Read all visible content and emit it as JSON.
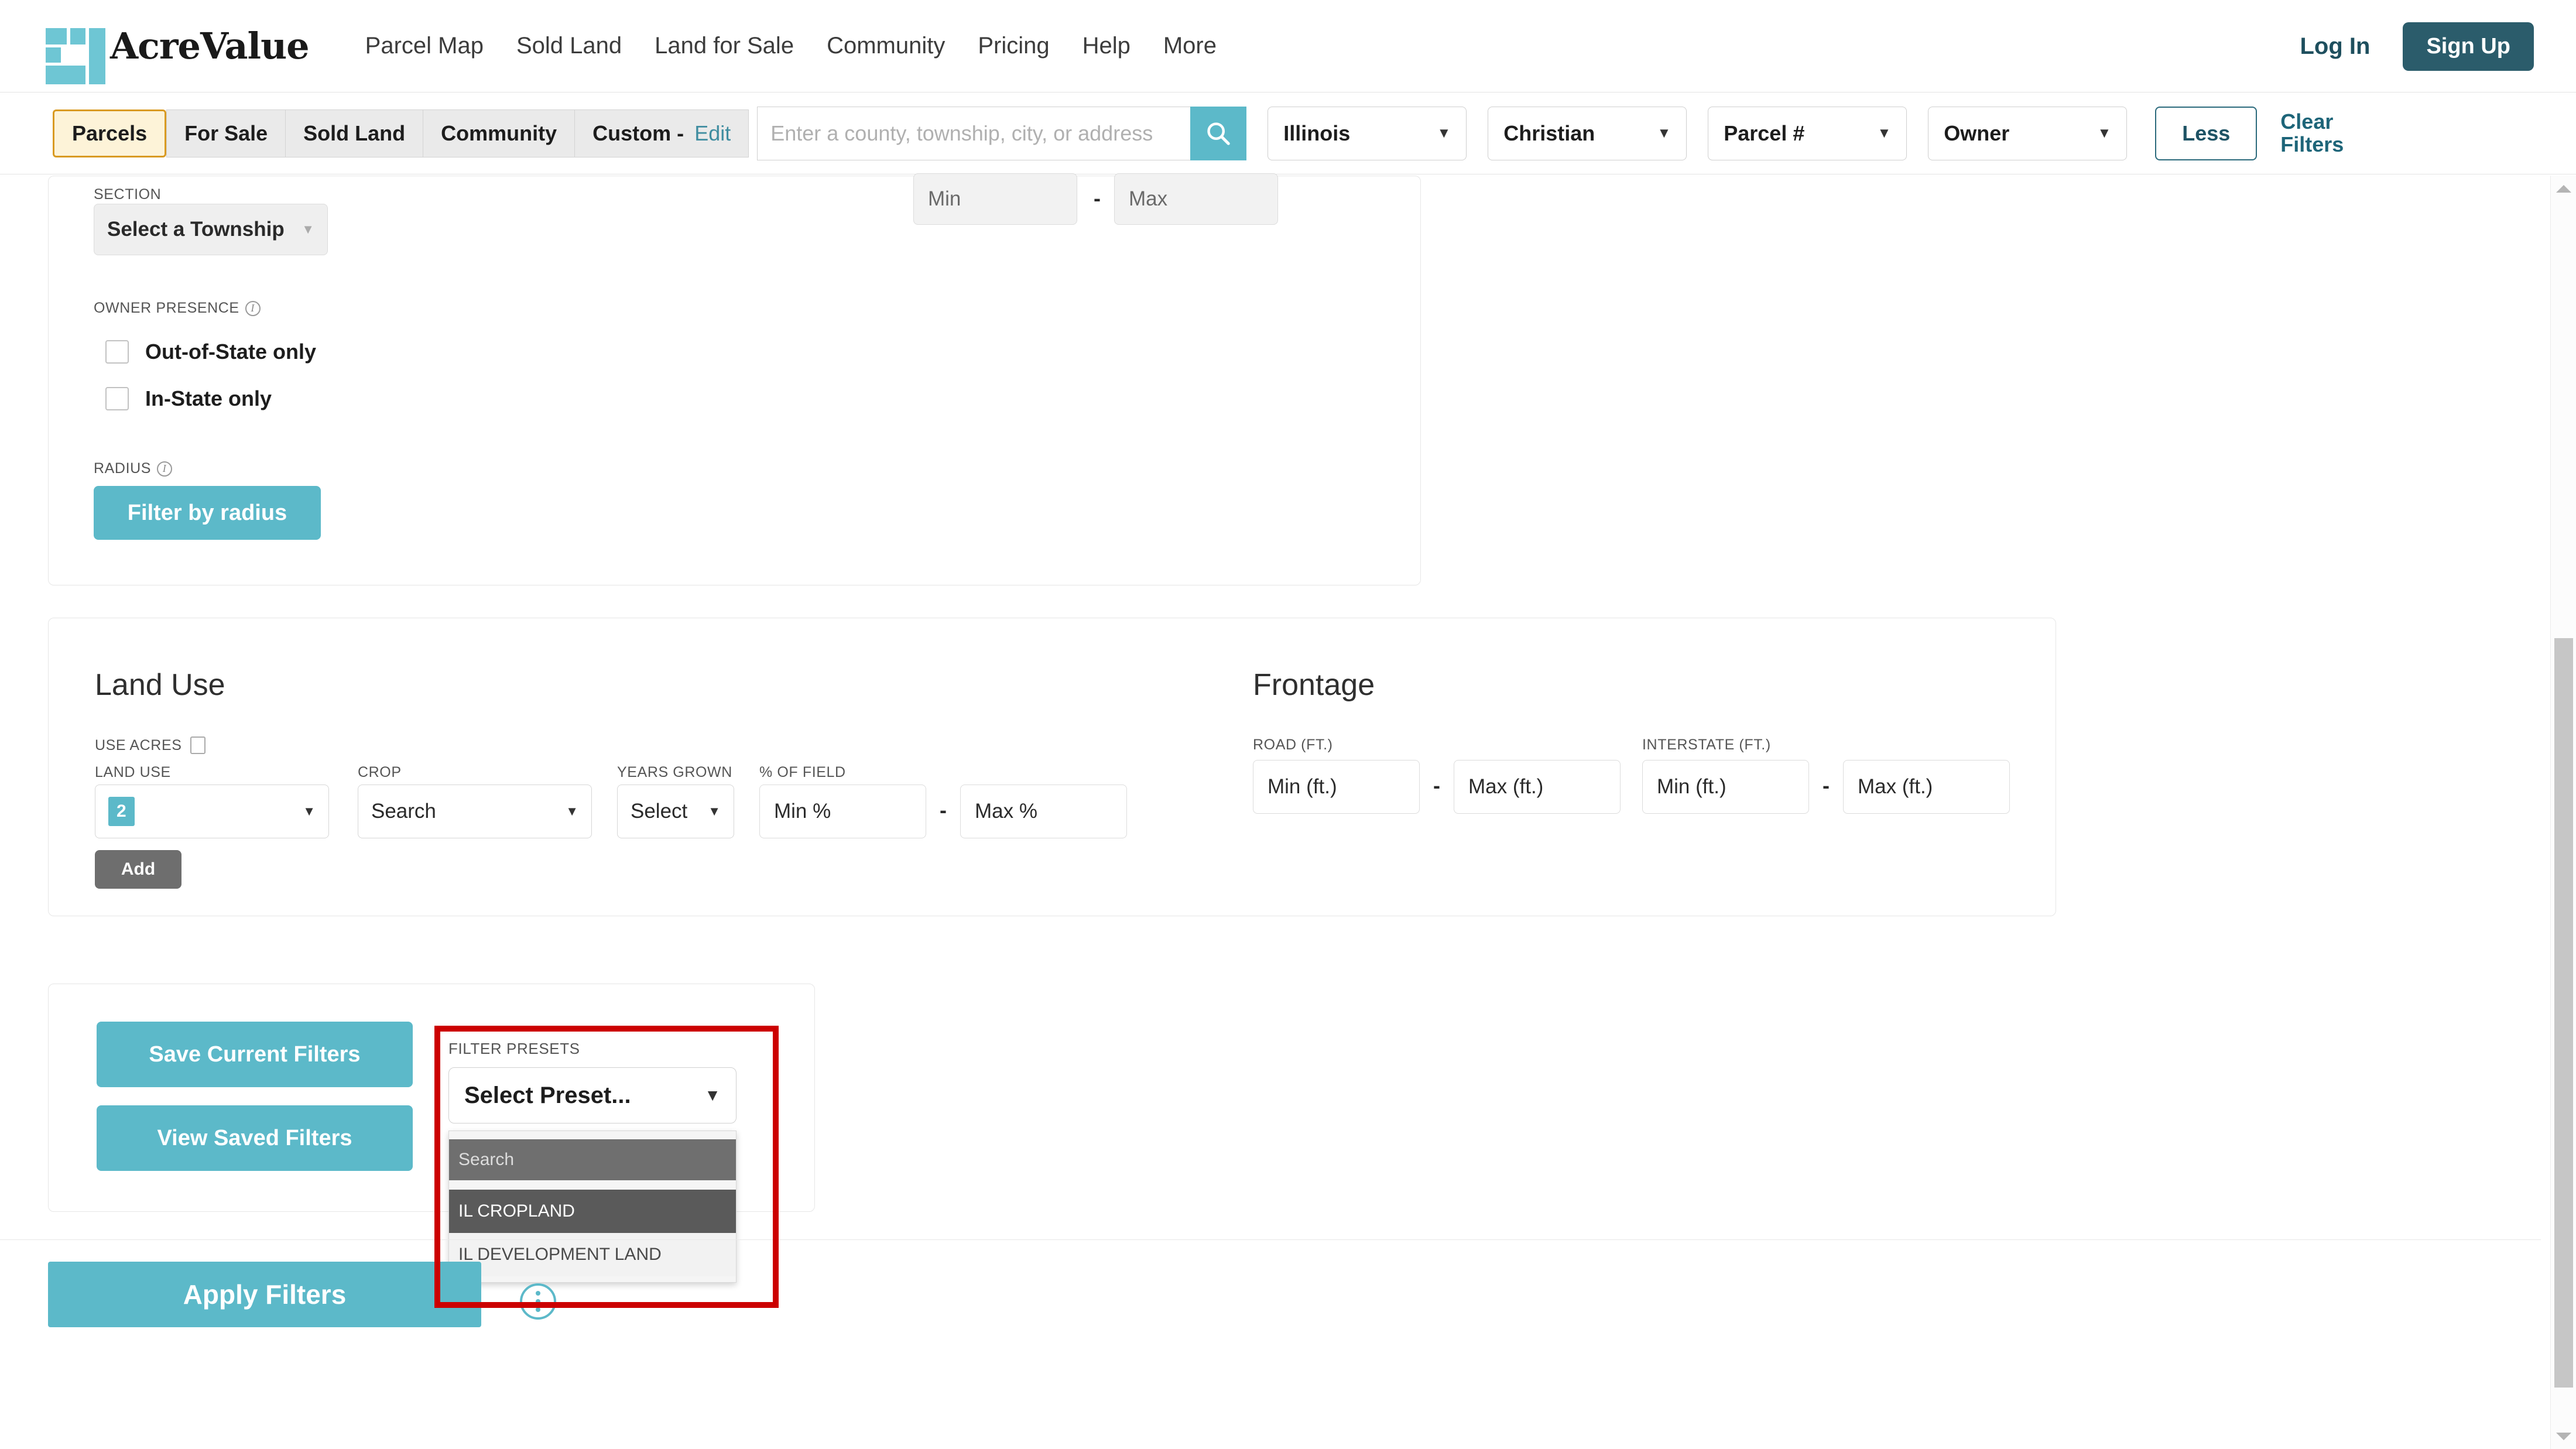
{
  "header": {
    "brand": "AcreValue",
    "nav": [
      {
        "label": "Parcel Map"
      },
      {
        "label": "Sold Land"
      },
      {
        "label": "Land for Sale"
      },
      {
        "label": "Community"
      },
      {
        "label": "Pricing"
      },
      {
        "label": "Help"
      },
      {
        "label": "More"
      }
    ],
    "login_label": "Log In",
    "signup_label": "Sign Up"
  },
  "filter_bar": {
    "tabs": [
      {
        "label": "Parcels",
        "active": true
      },
      {
        "label": "For Sale",
        "active": false
      },
      {
        "label": "Sold Land",
        "active": false
      },
      {
        "label": "Community",
        "active": false
      }
    ],
    "custom_label": "Custom -",
    "custom_edit_label": "Edit",
    "search_placeholder": "Enter a county, township, city, or address",
    "search_value": "",
    "search_icon": "search-icon",
    "state_dropdown": "Illinois",
    "county_dropdown": "Christian",
    "parcel_dropdown": "Parcel #",
    "owner_dropdown": "Owner",
    "less_label": "Less",
    "clear_filters_label": "Clear Filters"
  },
  "top_panel": {
    "section_label": "SECTION",
    "township_select": "Select a Township",
    "range_min_placeholder": "Min",
    "range_max_placeholder": "Max",
    "range_dash": "-",
    "owner_presence_label": "OWNER PRESENCE",
    "checkbox_out_of_state": "Out-of-State only",
    "checkbox_in_state": "In-State only",
    "radius_label": "RADIUS",
    "filter_by_radius_label": "Filter by radius"
  },
  "land_use": {
    "title": "Land Use",
    "use_acres_label": "USE ACRES",
    "col_land_use": "LAND USE",
    "col_crop": "CROP",
    "col_years_grown": "YEARS GROWN",
    "col_pct_of_field": "% OF FIELD",
    "land_use_count": "2",
    "crop_value": "Search",
    "years_grown_value": "Select",
    "min_pct_placeholder": "Min %",
    "max_pct_placeholder": "Max %",
    "dash": "-",
    "add_label": "Add"
  },
  "frontage": {
    "title": "Frontage",
    "road_label": "ROAD (FT.)",
    "interstate_label": "INTERSTATE (FT.)",
    "min_placeholder": "Min (ft.)",
    "max_placeholder": "Max (ft.)",
    "dash": "-"
  },
  "saved_filters": {
    "save_label": "Save Current Filters",
    "view_label": "View Saved Filters"
  },
  "filter_presets": {
    "label": "FILTER PRESETS",
    "selected": "Select Preset...",
    "caret_icon": "chevron-down-icon",
    "search_placeholder": "Search",
    "search_value": "",
    "options": [
      {
        "label": "IL CROPLAND",
        "highlighted": true
      },
      {
        "label": "IL DEVELOPMENT LAND",
        "highlighted": false
      }
    ],
    "highlight_color": "#cc0000"
  },
  "footer": {
    "apply_label": "Apply Filters",
    "kebab_icon": "more-options-icon"
  },
  "colors": {
    "teal": "#5cb9c9",
    "dark_teal": "#2b5c6b",
    "gold": "#d99a22",
    "highlight_red": "#cc0000"
  }
}
